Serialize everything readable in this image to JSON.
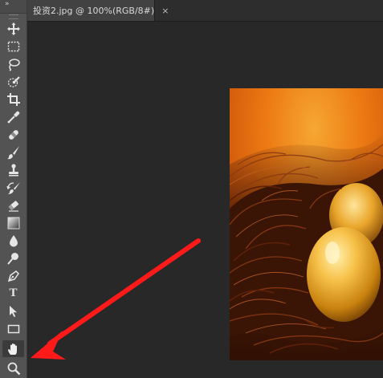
{
  "window": {
    "collapse_glyph": "»"
  },
  "document_tab": {
    "title": "投资2.jpg @ 100%(RGB/8#)",
    "close_glyph": "×"
  },
  "toolbar": {
    "type_tool_glyph": "T",
    "tools": [
      "move-tool",
      "rectangular-marquee-tool",
      "lasso-tool",
      "quick-selection-tool",
      "crop-tool",
      "eyedropper-tool",
      "spot-healing-brush-tool",
      "brush-tool",
      "clone-stamp-tool",
      "history-brush-tool",
      "eraser-tool",
      "gradient-tool",
      "blur-tool",
      "dodge-tool",
      "pen-tool",
      "type-tool",
      "path-selection-tool",
      "rectangle-tool",
      "hand-tool",
      "zoom-tool"
    ],
    "active_tool": "hand-tool"
  },
  "annotation": {
    "arrow_color": "#ff1a1a",
    "points_to": "zoom-tool"
  },
  "canvas": {
    "image_subject": "golden eggs in a bird nest",
    "image_colors": [
      "#e8710f",
      "#f29c2a",
      "#4a1a07",
      "#ffcc55"
    ]
  }
}
